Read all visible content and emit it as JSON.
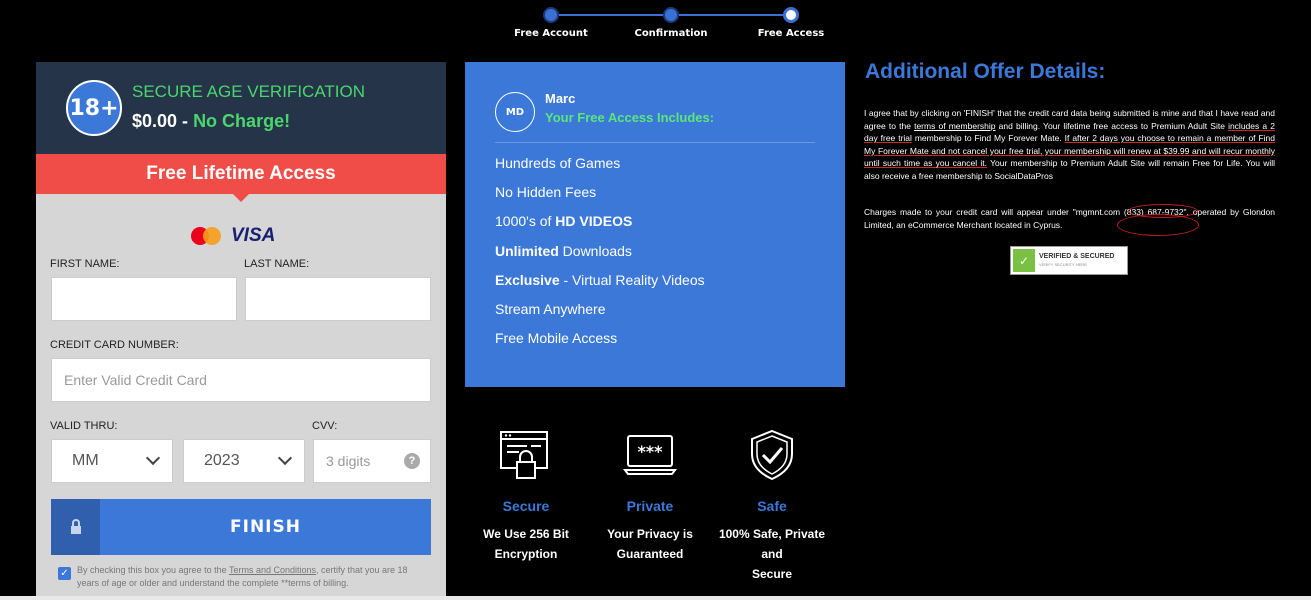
{
  "stepper": {
    "steps": [
      {
        "label": "Free Account"
      },
      {
        "label": "Confirmation"
      },
      {
        "label": "Free Access"
      }
    ]
  },
  "verification": {
    "badge": "18+",
    "title": "SECURE AGE VERIFICATION",
    "price": "$0.00 -",
    "price_note": "No Charge!",
    "banner": "Free Lifetime Access"
  },
  "card_brands": {
    "visa": "VISA",
    "icons": [
      "mastercard-icon",
      "visa-icon"
    ]
  },
  "form": {
    "first_name_label": "FIRST NAME:",
    "first_name_value": "",
    "last_name_label": "LAST NAME:",
    "last_name_value": "",
    "card_label": "CREDIT CARD NUMBER:",
    "card_placeholder": "Enter Valid Credit Card",
    "valid_thru_label": "VALID THRU:",
    "month_value": "MM",
    "year_value": "2023",
    "cvv_label": "CVV:",
    "cvv_placeholder": "3 digits",
    "cvv_help": "?",
    "finish_label": "FINISH",
    "agree_checked": true,
    "agree_text_1": "By checking this box you agree to the ",
    "agree_link": "Terms and Conditions",
    "agree_text_2": ", certify that you are 18 years of age or older and understand the complete **terms of billing."
  },
  "membership": {
    "avatar": "MD",
    "name": "Marc",
    "subtitle": "Your Free Access Includes:",
    "items": [
      {
        "pre": "",
        "bold": "",
        "post": "Hundreds of Games"
      },
      {
        "pre": "",
        "bold": "",
        "post": "No Hidden Fees"
      },
      {
        "pre": "1000's of ",
        "bold": "HD VIDEOS",
        "post": ""
      },
      {
        "pre": "",
        "bold": "Unlimited",
        "post": " Downloads"
      },
      {
        "pre": "",
        "bold": "Exclusive",
        "post": " - Virtual Reality Videos"
      },
      {
        "pre": "",
        "bold": "",
        "post": "Stream Anywhere"
      },
      {
        "pre": "",
        "bold": "",
        "post": "Free Mobile Access"
      }
    ]
  },
  "features": [
    {
      "icon": "secure-browser-icon",
      "title": "Secure",
      "line1": "We Use 256 Bit",
      "line2": "Encryption"
    },
    {
      "icon": "password-screen-icon",
      "title": "Private",
      "line1": "Your Privacy is",
      "line2": "Guaranteed"
    },
    {
      "icon": "shield-check-icon",
      "title": "Safe",
      "line1": "100% Safe, Private and",
      "line2": "Secure"
    }
  ],
  "offer": {
    "title": "Additional Offer Details:",
    "p1_a": "I agree that by clicking on 'FINISH' that the credit card data being submitted is mine and that I have read and agree to the ",
    "p1_link": "terms of membership",
    "p1_b": " and billing. Your lifetime free access to Premium Adult Site ",
    "p1_c": "includes a 2 day free trial",
    "p1_d": " membership to Find My Forever Mate. ",
    "p1_e": "If after 2 days you choose to remain a member of Find My Forever Mate and not cancel your free trial, your membership will renew at $39.99 and will recur monthly until such time as you cancel it.",
    "p1_f": " Your membership to Premium Adult Site will remain Free for Life. You will also receive a free membership to SocialDataPros",
    "p2": "Charges made to your credit card will appear under \"mgmnt.com (833) 687-9732\", operated by Glondon Limited, an eCommerce Merchant located in Cyprus.",
    "verified_title": "VERIFIED & SECURED",
    "verified_sub": "VERIFY SECURITY HERE"
  }
}
